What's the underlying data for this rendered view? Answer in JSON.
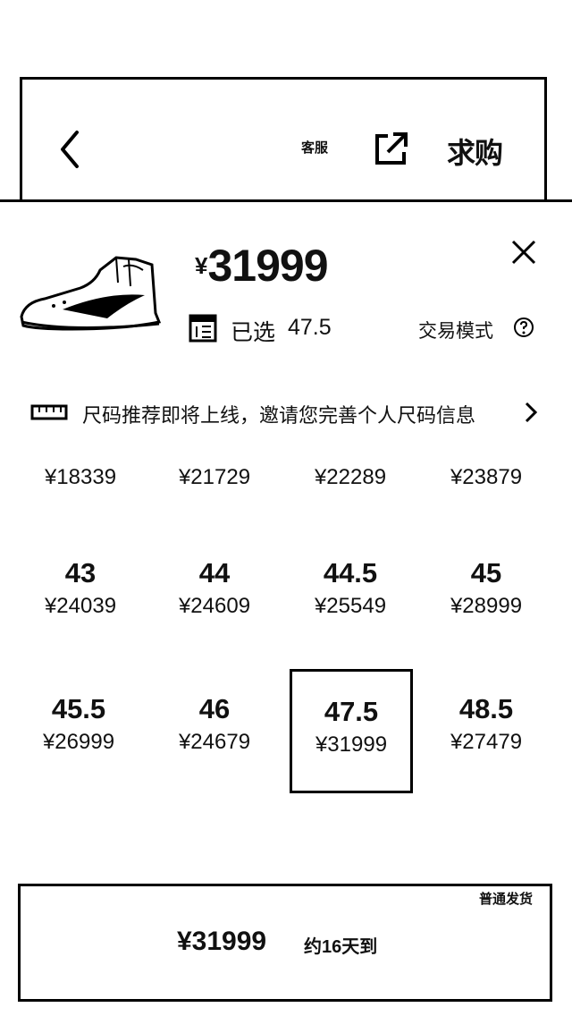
{
  "header": {
    "customer_service_label": "客服",
    "want_to_buy_label": "求购"
  },
  "product": {
    "currency": "¥",
    "price": "31999",
    "selected_prefix": "已选",
    "selected_size": "47.5",
    "trade_mode_label": "交易模式"
  },
  "notice": {
    "text": "尺码推荐即将上线，邀请您完善个人尺码信息"
  },
  "sizes": [
    {
      "size": "",
      "price": "¥18339"
    },
    {
      "size": "",
      "price": "¥21729"
    },
    {
      "size": "",
      "price": "¥22289"
    },
    {
      "size": "",
      "price": "¥23879"
    },
    {
      "size": "43",
      "price": "¥24039"
    },
    {
      "size": "44",
      "price": "¥24609"
    },
    {
      "size": "44.5",
      "price": "¥25549"
    },
    {
      "size": "45",
      "price": "¥28999"
    },
    {
      "size": "45.5",
      "price": "¥26999"
    },
    {
      "size": "46",
      "price": "¥24679"
    },
    {
      "size": "47.5",
      "price": "¥31999"
    },
    {
      "size": "48.5",
      "price": "¥27479"
    }
  ],
  "bottom": {
    "badge": "普通发货",
    "price": "¥31999",
    "eta": "约16天到"
  }
}
